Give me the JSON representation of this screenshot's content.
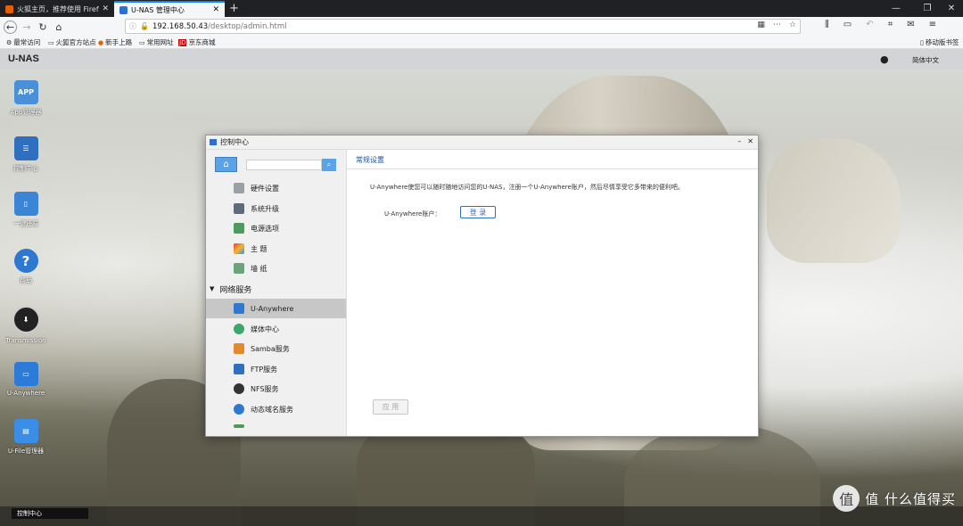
{
  "browser": {
    "tabs": [
      {
        "label": "火狐主页，推荐使用 Firefox 火",
        "active": false
      },
      {
        "label": "U-NAS 管理中心",
        "active": true
      }
    ],
    "url_host": "192.168.50.43",
    "url_path": "/desktop/admin.html",
    "bookmarks": [
      "最常访问",
      "火狐官方站点",
      "新手上路",
      "常用网址",
      "京东商城"
    ],
    "mobile_bookmarks": "移动版书签"
  },
  "app": {
    "brand": "U-NAS",
    "language": "简体中文"
  },
  "desktop_icons": [
    {
      "label": "App管理器",
      "icon": "app-store-icon",
      "color": "#4a90d9"
    },
    {
      "label": "控制中心",
      "icon": "control-panel-icon",
      "color": "#2f6fbf"
    },
    {
      "label": "一键还原",
      "icon": "mouse-icon",
      "color": "#3c85d6"
    },
    {
      "label": "帮助",
      "icon": "help-icon",
      "color": "#2f78d0"
    },
    {
      "label": "Transmission",
      "icon": "transmission-icon",
      "color": "#222222"
    },
    {
      "label": "U-Anywhere",
      "icon": "monitor-icon",
      "color": "#2c7bd8"
    },
    {
      "label": "U-File管理器",
      "icon": "folder-icon",
      "color": "#3a8ee6"
    }
  ],
  "window": {
    "title": "控制中心",
    "sidebar_items": [
      {
        "label": "硬件设置",
        "icon": "hardware-icon",
        "color": "#9aa0a6"
      },
      {
        "label": "系统升级",
        "icon": "upgrade-icon",
        "color": "#5f6a7a"
      },
      {
        "label": "电源选项",
        "icon": "power-icon",
        "color": "#4c9a5e"
      },
      {
        "label": "主 题",
        "icon": "theme-icon",
        "color": "#e46b2d"
      },
      {
        "label": "墙 纸",
        "icon": "wallpaper-icon",
        "color": "#6aa57a"
      }
    ],
    "group_label": "网络服务",
    "service_items": [
      {
        "label": "U-Anywhere",
        "icon": "u-anywhere-icon",
        "color": "#2f78d0",
        "active": true
      },
      {
        "label": "媒体中心",
        "icon": "media-center-icon",
        "color": "#3aa86b",
        "active": false
      },
      {
        "label": "Samba服务",
        "icon": "samba-icon",
        "color": "#e38a2d",
        "active": false
      },
      {
        "label": "FTP服务",
        "icon": "ftp-icon",
        "color": "#2f6fbf",
        "active": false
      },
      {
        "label": "NFS服务",
        "icon": "nfs-icon",
        "color": "#333333",
        "active": false
      },
      {
        "label": "动态域名服务",
        "icon": "ddns-icon",
        "color": "#2f78d0",
        "active": false
      }
    ],
    "section_title": "常规设置",
    "description": "U-Anywhere使您可以随时随地访问您的U-NAS，注册一个U-Anywhere账户，然后尽情享受它多带来的便利吧。",
    "account_label": "U-Anywhere账户：",
    "login_button": "登 录",
    "apply_button": "应 用"
  },
  "taskbar": {
    "items": [
      "控制中心"
    ]
  },
  "watermark": "值 什么值得买"
}
